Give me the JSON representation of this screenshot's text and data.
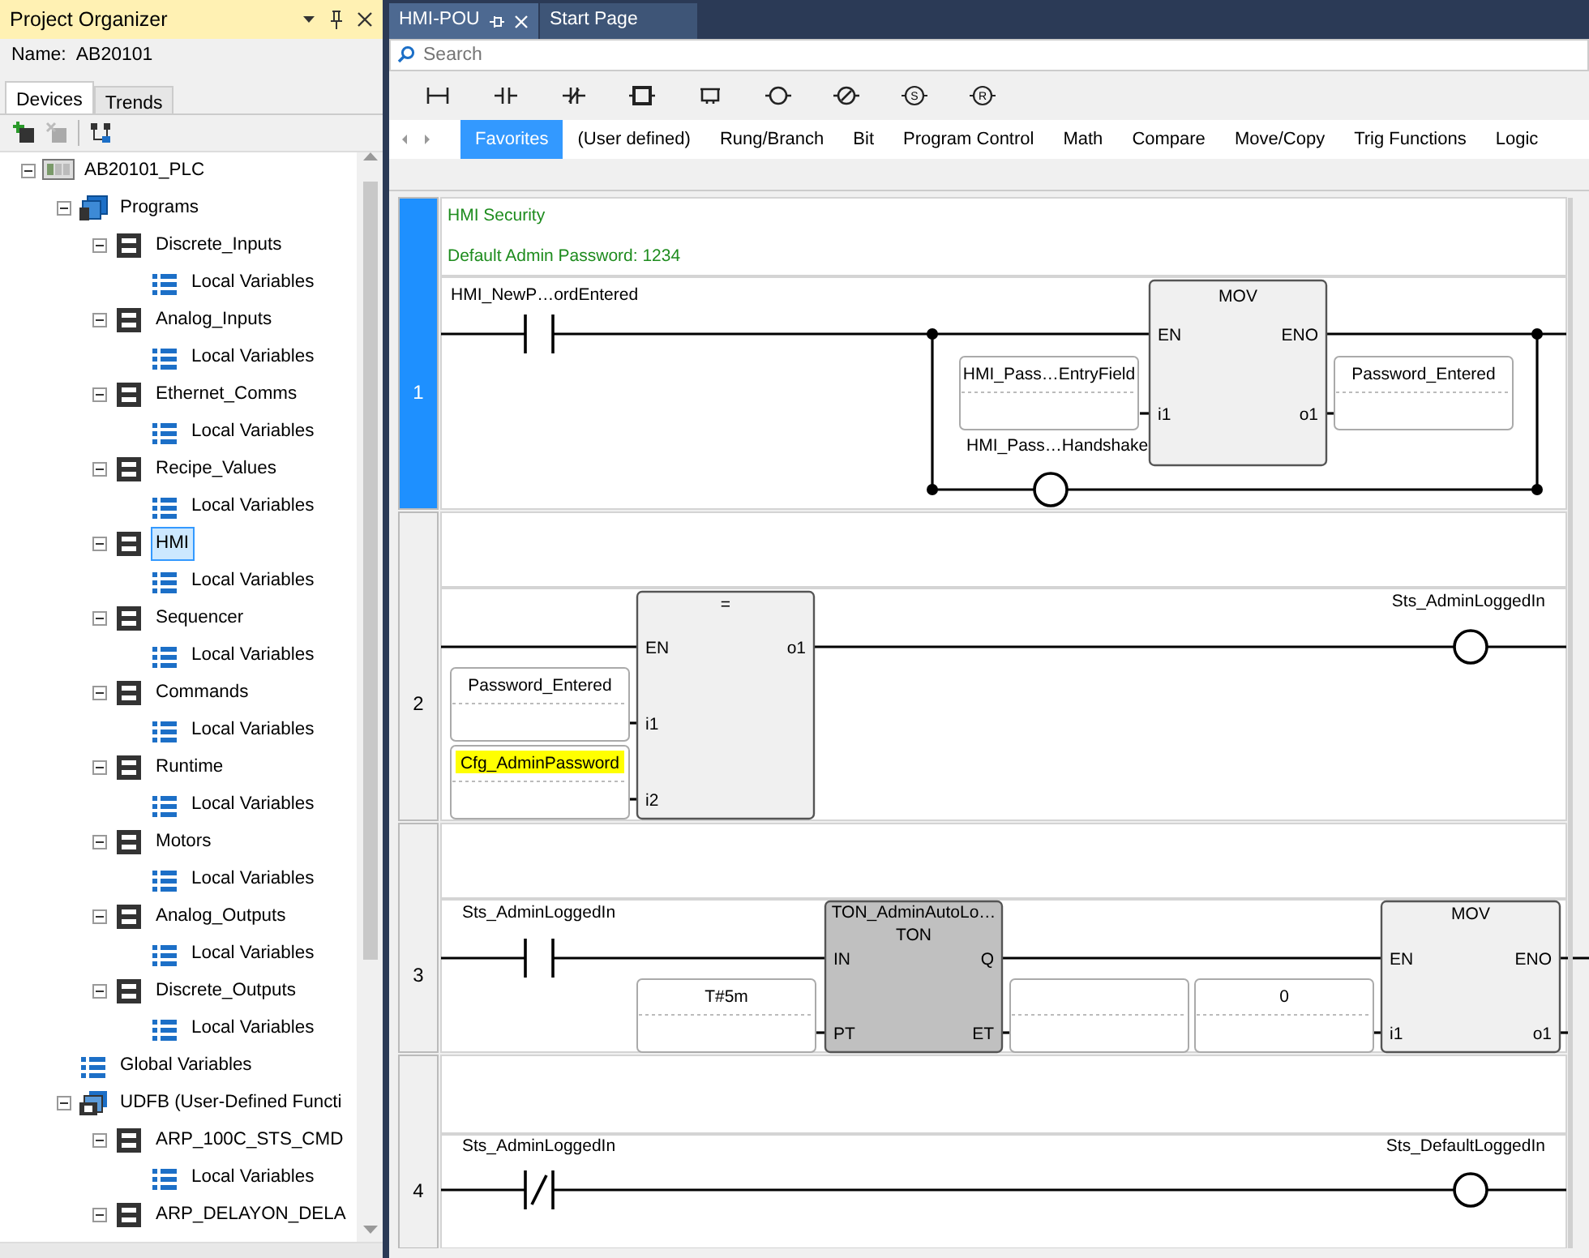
{
  "panel": {
    "title": "Project Organizer",
    "name_label": "Name:",
    "name_value": "AB20101",
    "tabs": [
      {
        "label": "Devices",
        "selected": true
      },
      {
        "label": "Trends",
        "selected": false
      }
    ],
    "tree": [
      {
        "label": "AB20101_PLC",
        "kind": "plc",
        "expanded": true,
        "selected": false,
        "children": [
          {
            "label": "Programs",
            "kind": "folder",
            "expanded": true,
            "selected": false,
            "children": [
              {
                "label": "Discrete_Inputs",
                "kind": "pou",
                "expanded": true,
                "selected": false,
                "children": [
                  {
                    "label": "Local Variables",
                    "kind": "vars",
                    "selected": false
                  }
                ]
              },
              {
                "label": "Analog_Inputs",
                "kind": "pou",
                "expanded": true,
                "selected": false,
                "children": [
                  {
                    "label": "Local Variables",
                    "kind": "vars",
                    "selected": false
                  }
                ]
              },
              {
                "label": "Ethernet_Comms",
                "kind": "pou",
                "expanded": true,
                "selected": false,
                "children": [
                  {
                    "label": "Local Variables",
                    "kind": "vars",
                    "selected": false
                  }
                ]
              },
              {
                "label": "Recipe_Values",
                "kind": "pou",
                "expanded": true,
                "selected": false,
                "children": [
                  {
                    "label": "Local Variables",
                    "kind": "vars",
                    "selected": false
                  }
                ]
              },
              {
                "label": "HMI",
                "kind": "pou",
                "expanded": true,
                "selected": true,
                "children": [
                  {
                    "label": "Local Variables",
                    "kind": "vars",
                    "selected": false
                  }
                ]
              },
              {
                "label": "Sequencer",
                "kind": "pou",
                "expanded": true,
                "selected": false,
                "children": [
                  {
                    "label": "Local Variables",
                    "kind": "vars",
                    "selected": false
                  }
                ]
              },
              {
                "label": "Commands",
                "kind": "pou",
                "expanded": true,
                "selected": false,
                "children": [
                  {
                    "label": "Local Variables",
                    "kind": "vars",
                    "selected": false
                  }
                ]
              },
              {
                "label": "Runtime",
                "kind": "pou",
                "expanded": true,
                "selected": false,
                "children": [
                  {
                    "label": "Local Variables",
                    "kind": "vars",
                    "selected": false
                  }
                ]
              },
              {
                "label": "Motors",
                "kind": "pou",
                "expanded": true,
                "selected": false,
                "children": [
                  {
                    "label": "Local Variables",
                    "kind": "vars",
                    "selected": false
                  }
                ]
              },
              {
                "label": "Analog_Outputs",
                "kind": "pou",
                "expanded": true,
                "selected": false,
                "children": [
                  {
                    "label": "Local Variables",
                    "kind": "vars",
                    "selected": false
                  }
                ]
              },
              {
                "label": "Discrete_Outputs",
                "kind": "pou",
                "expanded": true,
                "selected": false,
                "children": [
                  {
                    "label": "Local Variables",
                    "kind": "vars",
                    "selected": false
                  }
                ]
              }
            ]
          },
          {
            "label": "Global Variables",
            "kind": "vars",
            "selected": false
          },
          {
            "label": "UDFB (User-Defined Functi",
            "kind": "udfb",
            "expanded": true,
            "selected": false,
            "children": [
              {
                "label": "ARP_100C_STS_CMD",
                "kind": "pou",
                "expanded": true,
                "selected": false,
                "children": [
                  {
                    "label": "Local Variables",
                    "kind": "vars",
                    "selected": false
                  }
                ]
              },
              {
                "label": "ARP_DELAYON_DELA",
                "kind": "pou",
                "expanded": true,
                "selected": false
              }
            ]
          }
        ]
      }
    ]
  },
  "editor_tabs": [
    {
      "label": "HMI-POU",
      "selected": true
    },
    {
      "label": "Start Page",
      "selected": false
    }
  ],
  "search": {
    "placeholder": "Search"
  },
  "tools": [
    {
      "kind": "branch"
    },
    {
      "kind": "contact"
    },
    {
      "kind": "negated-contact"
    },
    {
      "kind": "block"
    },
    {
      "kind": "box"
    },
    {
      "kind": "coil"
    },
    {
      "kind": "negated-coil"
    },
    {
      "kind": "letter-coil",
      "letter": "S"
    },
    {
      "kind": "letter-coil",
      "letter": "R"
    }
  ],
  "categories": [
    {
      "label": "Favorites",
      "selected": true
    },
    {
      "label": "(User defined)",
      "selected": false
    },
    {
      "label": "Rung/Branch",
      "selected": false
    },
    {
      "label": "Bit",
      "selected": false
    },
    {
      "label": "Program Control",
      "selected": false
    },
    {
      "label": "Math",
      "selected": false
    },
    {
      "label": "Compare",
      "selected": false
    },
    {
      "label": "Move/Copy",
      "selected": false
    },
    {
      "label": "Trig Functions",
      "selected": false
    },
    {
      "label": "Logic",
      "selected": false
    }
  ],
  "rungs": [
    {
      "number": "1",
      "selected": true,
      "comment": [
        "HMI Security",
        "Default Admin Password: 1234"
      ],
      "elements": [
        {
          "kind": "contact",
          "label": "HMI_NewP…ordEntered",
          "negated": false
        },
        {
          "kind": "block",
          "title": "MOV",
          "shaded": false,
          "inputs": [
            "EN",
            "i1"
          ],
          "outputs": [
            "ENO",
            "o1"
          ]
        },
        {
          "kind": "variable",
          "text": "HMI_Pass…EntryField"
        },
        {
          "kind": "variable",
          "text": "Password_Entered"
        },
        {
          "kind": "coil",
          "label": "HMI_Pass…Handshake",
          "negated": false
        }
      ]
    },
    {
      "number": "2",
      "selected": false,
      "elements": [
        {
          "kind": "block",
          "title": "=",
          "shaded": false,
          "inputs": [
            "EN",
            "i1",
            "i2"
          ],
          "outputs": [
            "o1"
          ]
        },
        {
          "kind": "variable",
          "text": "Password_Entered"
        },
        {
          "kind": "variable",
          "text": "Cfg_AdminPassword",
          "highlighted": true
        },
        {
          "kind": "coil",
          "label": "Sts_AdminLoggedIn",
          "negated": false
        }
      ]
    },
    {
      "number": "3",
      "selected": false,
      "elements": [
        {
          "kind": "contact",
          "label": "Sts_AdminLoggedIn",
          "negated": false
        },
        {
          "kind": "block",
          "instance": "TON_AdminAutoLo…",
          "title": "TON",
          "shaded": true,
          "inputs": [
            "IN",
            "PT"
          ],
          "outputs": [
            "Q",
            "ET"
          ]
        },
        {
          "kind": "variable",
          "text": "T#5m"
        },
        {
          "kind": "variable"
        },
        {
          "kind": "variable",
          "text": "0"
        },
        {
          "kind": "block",
          "title": "MOV",
          "shaded": false,
          "inputs": [
            "EN",
            "i1"
          ],
          "outputs": [
            "ENO",
            "o1"
          ]
        }
      ]
    },
    {
      "number": "4",
      "selected": false,
      "elements": [
        {
          "kind": "contact",
          "label": "Sts_AdminLoggedIn",
          "negated": true
        },
        {
          "kind": "coil",
          "label": "Sts_DefaultLoggedIn",
          "negated": false
        }
      ]
    }
  ]
}
